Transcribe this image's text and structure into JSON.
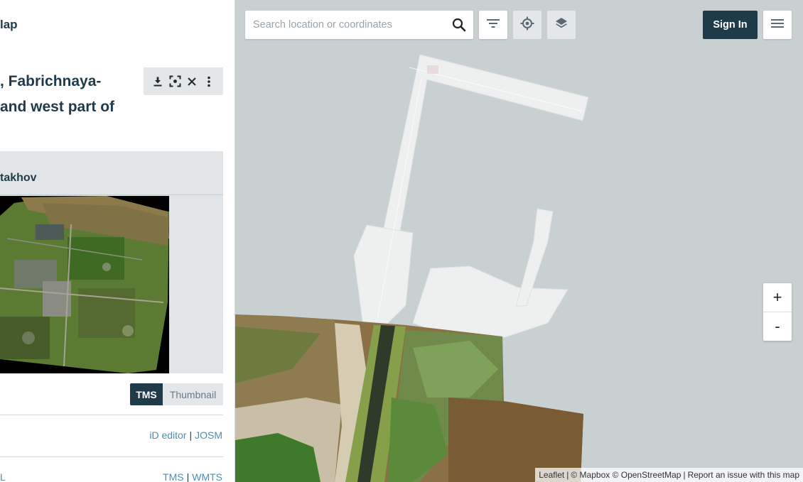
{
  "sidebar": {
    "brand": "lap",
    "title_lines": [
      ", Fabrichnaya-",
      "and west part of"
    ],
    "tools": {
      "download": "download-icon",
      "zoom_to": "zoom-to-extent-icon",
      "close": "close-icon",
      "more": "more-vertical-icon"
    },
    "provider": "takhov",
    "layer_toggle": {
      "active": "TMS",
      "inactive": "Thumbnail"
    },
    "edit_links": {
      "first": "iD editor",
      "separator": "|",
      "second": "JOSM"
    },
    "service_links": {
      "first": "TMS",
      "separator": "|",
      "second": "WMTS"
    },
    "cut_off_label": "L"
  },
  "map": {
    "search": {
      "placeholder": "Search location or coordinates"
    },
    "buttons": {
      "filter": "filter-icon",
      "locate": "locate-icon",
      "layers": "layers-icon",
      "menu": "menu-icon"
    },
    "signin_label": "Sign In",
    "zoom": {
      "in": "+",
      "out": "-"
    },
    "attribution": {
      "leaflet": "Leaflet",
      "sep": "|",
      "credits": "© Mapbox © OpenStreetMap",
      "report": "Report an issue with this map"
    }
  },
  "colors": {
    "primary": "#1f3a48",
    "link": "#4a8fb8",
    "map_water": "#c9d0d2",
    "land": "#eef0f0"
  }
}
